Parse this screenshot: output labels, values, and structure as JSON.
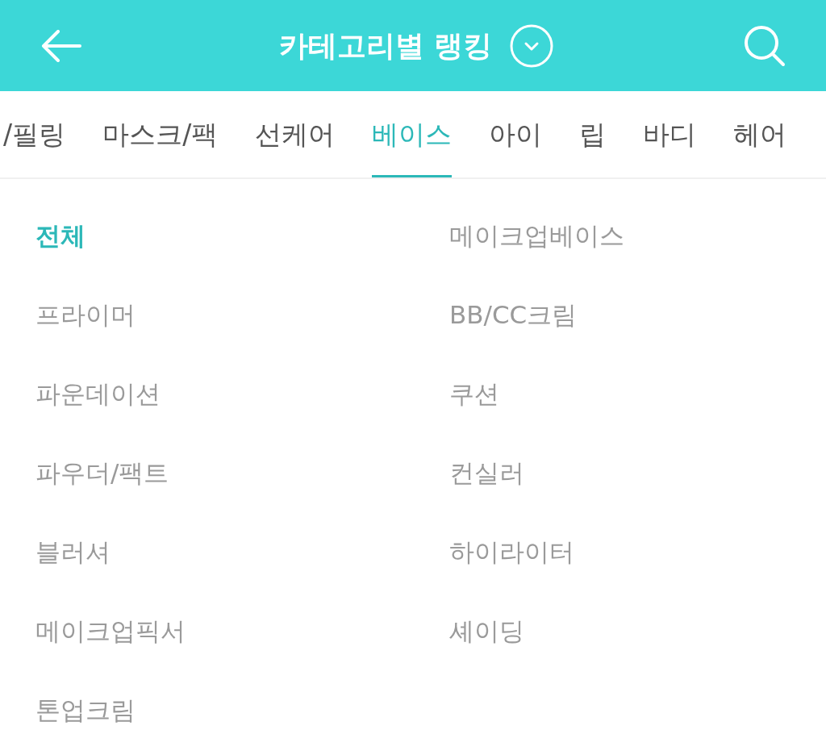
{
  "header": {
    "title": "카테고리별 랭킹"
  },
  "tabs": [
    {
      "label": "/필링",
      "selected": false
    },
    {
      "label": "마스크/팩",
      "selected": false
    },
    {
      "label": "선케어",
      "selected": false
    },
    {
      "label": "베이스",
      "selected": true
    },
    {
      "label": "아이",
      "selected": false
    },
    {
      "label": "립",
      "selected": false
    },
    {
      "label": "바디",
      "selected": false
    },
    {
      "label": "헤어",
      "selected": false
    }
  ],
  "categories": [
    {
      "label": "전체",
      "selected": true
    },
    {
      "label": "메이크업베이스",
      "selected": false
    },
    {
      "label": "프라이머",
      "selected": false
    },
    {
      "label": "BB/CC크림",
      "selected": false
    },
    {
      "label": "파운데이션",
      "selected": false
    },
    {
      "label": "쿠션",
      "selected": false
    },
    {
      "label": "파우더/팩트",
      "selected": false
    },
    {
      "label": "컨실러",
      "selected": false
    },
    {
      "label": "블러셔",
      "selected": false
    },
    {
      "label": "하이라이터",
      "selected": false
    },
    {
      "label": "메이크업픽서",
      "selected": false
    },
    {
      "label": "셰이딩",
      "selected": false
    },
    {
      "label": "톤업크림",
      "selected": false
    }
  ]
}
